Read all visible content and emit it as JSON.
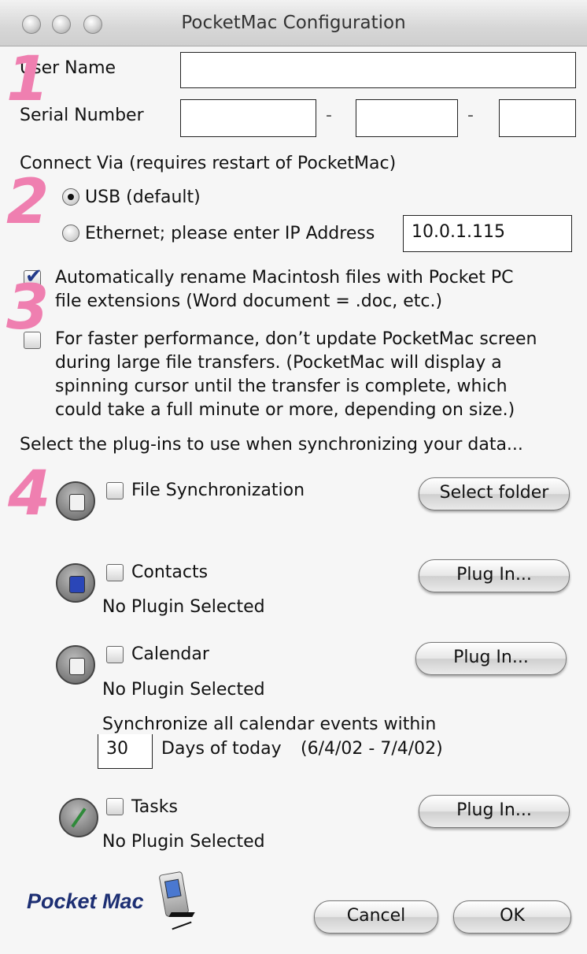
{
  "window": {
    "title": "PocketMac Configuration"
  },
  "account": {
    "user_name_label": "User Name",
    "user_name_value": "",
    "serial_label": "Serial Number",
    "serial_part1": "",
    "serial_part2": "",
    "serial_part3": "",
    "dash": "-"
  },
  "connection": {
    "heading": "Connect Via (requires restart of PocketMac)",
    "usb_label": "USB (default)",
    "ethernet_label": "Ethernet; please enter IP Address",
    "ip_value": "10.0.1.115",
    "selected": "usb"
  },
  "options": {
    "rename_line1": "Automatically rename Macintosh files with Pocket PC",
    "rename_line2": "file extensions (Word document = .doc, etc.)",
    "rename_checked": true,
    "perf_line1": "For faster performance, don’t update PocketMac screen",
    "perf_line2": "during large file transfers. (PocketMac will display a",
    "perf_line3": "spinning cursor until the transfer is complete, which",
    "perf_line4": "could take a full minute or more, depending on size.)",
    "perf_checked": false
  },
  "plugins": {
    "heading": "Select the plug-ins to use when synchronizing your data...",
    "file_sync": {
      "label": "File Synchronization",
      "button": "Select folder"
    },
    "contacts": {
      "label": "Contacts",
      "button": "Plug In...",
      "status": "No Plugin Selected"
    },
    "calendar": {
      "label": "Calendar",
      "button": "Plug In...",
      "status": "No Plugin Selected",
      "sync_line": "Synchronize all calendar events within",
      "days_value": "30",
      "days_label": "Days of today",
      "date_range": "(6/4/02 - 7/4/02)"
    },
    "tasks": {
      "label": "Tasks",
      "button": "Plug In...",
      "status": "No Plugin Selected"
    }
  },
  "annotations": {
    "step1": "1",
    "step2": "2",
    "step3": "3",
    "step4": "4"
  },
  "footer": {
    "logo_text_a": "Pocket",
    "logo_text_b": "Mac",
    "cancel": "Cancel",
    "ok": "OK"
  },
  "colors": {
    "annotation": "#ef7fb0",
    "logo": "#1d2f73",
    "checkmark": "#223a8a"
  }
}
